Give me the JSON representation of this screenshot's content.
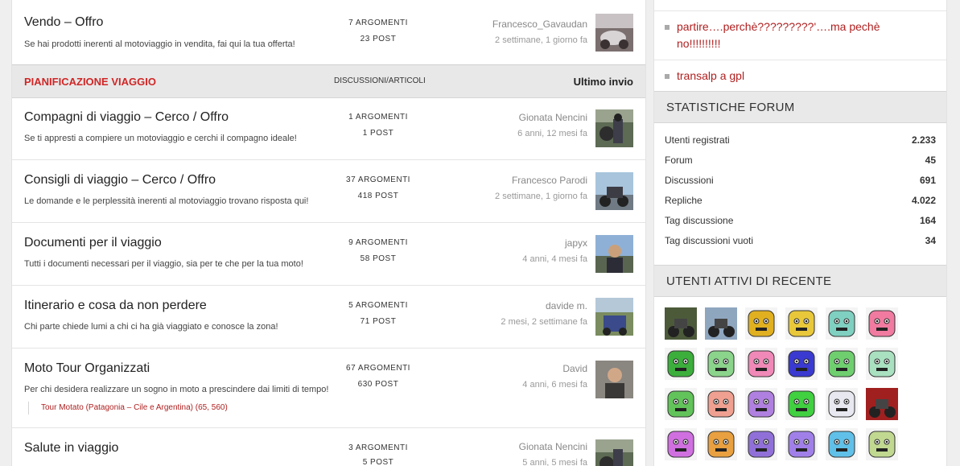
{
  "forums_top": [
    {
      "title": "Vendo – Offro",
      "description": "Se hai prodotti inerenti al motoviaggio in vendita, fai qui la tua offerta!",
      "topics": "7 ARGOMENTI",
      "posts": "23 POST",
      "last_user": "Francesco_Gavaudan",
      "last_time": "2 settimane, 1 giorno fa"
    }
  ],
  "category": {
    "name": "PIANIFICAZIONE VIAGGIO",
    "col_topics": "DISCUSSIONI/ARTICOLI",
    "col_last": "Ultimo invio"
  },
  "forums": [
    {
      "title": "Compagni di viaggio – Cerco / Offro",
      "description": "Se ti appresti a compiere un motoviaggio e cerchi il compagno ideale!",
      "topics": "1 ARGOMENTI",
      "posts": "1 POST",
      "last_user": "Gionata Nencini",
      "last_time": "6 anni, 12 mesi fa"
    },
    {
      "title": "Consigli di viaggio – Cerco / Offro",
      "description": "Le domande e le perplessità inerenti al motoviaggio trovano risposta qui!",
      "topics": "37 ARGOMENTI",
      "posts": "418 POST",
      "last_user": "Francesco Parodi",
      "last_time": "2 settimane, 1 giorno fa"
    },
    {
      "title": "Documenti per il viaggio",
      "description": "Tutti i documenti necessari per il viaggio, sia per te che per la tua moto!",
      "topics": "9 ARGOMENTI",
      "posts": "58 POST",
      "last_user": "japyx",
      "last_time": "4 anni, 4 mesi fa"
    },
    {
      "title": "Itinerario e cosa da non perdere",
      "description": "Chi parte chiede lumi a chi ci ha già viaggiato e conosce la zona!",
      "topics": "5 ARGOMENTI",
      "posts": "71 POST",
      "last_user": "davide m.",
      "last_time": "2 mesi, 2 settimane fa"
    },
    {
      "title": "Moto Tour Organizzati",
      "description": "Per chi desidera realizzare un sogno in moto a prescindere dai limiti di tempo!",
      "topics": "67 ARGOMENTI",
      "posts": "630 POST",
      "last_user": "David",
      "last_time": "4 anni, 6 mesi fa",
      "subforum": "Tour Motato (Patagonia – Cile e Argentina) (65, 560)"
    },
    {
      "title": "Salute in viaggio",
      "description": "",
      "topics": "3 ARGOMENTI",
      "posts": "5 POST",
      "last_user": "Gionata Nencini",
      "last_time": "5 anni, 5 mesi fa"
    }
  ],
  "sidebar": {
    "recent_topics": [
      "partire….perchè?????????'….ma pechè no!!!!!!!!!!",
      "transalp a gpl"
    ],
    "stats_title": "STATISTICHE FORUM",
    "stats": [
      {
        "label": "Utenti registrati",
        "value": "2.233"
      },
      {
        "label": "Forum",
        "value": "45"
      },
      {
        "label": "Discussioni",
        "value": "691"
      },
      {
        "label": "Repliche",
        "value": "4.022"
      },
      {
        "label": "Tag discussione",
        "value": "164"
      },
      {
        "label": "Tag discussioni vuoti",
        "value": "34"
      }
    ],
    "active_title": "UTENTI ATTIVI DI RECENTE",
    "avatars": [
      {
        "kind": "photo",
        "color": "#4c5a3a"
      },
      {
        "kind": "photo",
        "color": "#8fa6bf"
      },
      {
        "kind": "face",
        "color": "#e0b020"
      },
      {
        "kind": "face",
        "color": "#e8c83a"
      },
      {
        "kind": "face",
        "color": "#7fd0c0"
      },
      {
        "kind": "face",
        "color": "#f07aa0"
      },
      {
        "kind": "face",
        "color": "#3cae3c"
      },
      {
        "kind": "face",
        "color": "#8bd48b"
      },
      {
        "kind": "face",
        "color": "#f089b7"
      },
      {
        "kind": "face",
        "color": "#3a3ad0"
      },
      {
        "kind": "face",
        "color": "#6fcf6f"
      },
      {
        "kind": "face",
        "color": "#a8e0c0"
      },
      {
        "kind": "face",
        "color": "#62c35a"
      },
      {
        "kind": "face",
        "color": "#f0a090"
      },
      {
        "kind": "face",
        "color": "#b080e0"
      },
      {
        "kind": "face",
        "color": "#40d040"
      },
      {
        "kind": "face",
        "color": "#e8e8f0"
      },
      {
        "kind": "photo",
        "color": "#a02020"
      },
      {
        "kind": "face",
        "color": "#d070e0"
      },
      {
        "kind": "face",
        "color": "#e8a040"
      },
      {
        "kind": "face",
        "color": "#9070d8"
      },
      {
        "kind": "face",
        "color": "#a080e8"
      },
      {
        "kind": "face",
        "color": "#60c0e8"
      },
      {
        "kind": "face",
        "color": "#c0d890"
      }
    ]
  }
}
